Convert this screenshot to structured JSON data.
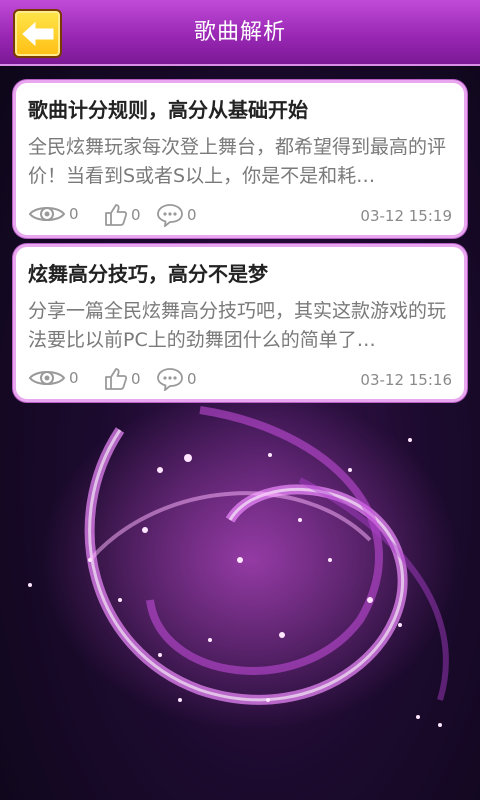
{
  "header": {
    "title": "歌曲解析",
    "back_icon": "arrow-left-icon",
    "accent": "#9a28b5"
  },
  "articles": [
    {
      "title": "歌曲计分规则，高分从基础开始",
      "excerpt": "全民炫舞玩家每次登上舞台，都希望得到最高的评价！当看到S或者S以上，你是不是和耗…",
      "views": "0",
      "likes": "0",
      "comments": "0",
      "date": "03-12 15:19"
    },
    {
      "title": "炫舞高分技巧，高分不是梦",
      "excerpt": "分享一篇全民炫舞高分技巧吧，其实这款游戏的玩法要比以前PC上的劲舞团什么的简单了…",
      "views": "0",
      "likes": "0",
      "comments": "0",
      "date": "03-12 15:16"
    }
  ],
  "icons": {
    "views": "eye-icon",
    "likes": "thumbs-up-icon",
    "comments": "comment-bubble-icon"
  }
}
